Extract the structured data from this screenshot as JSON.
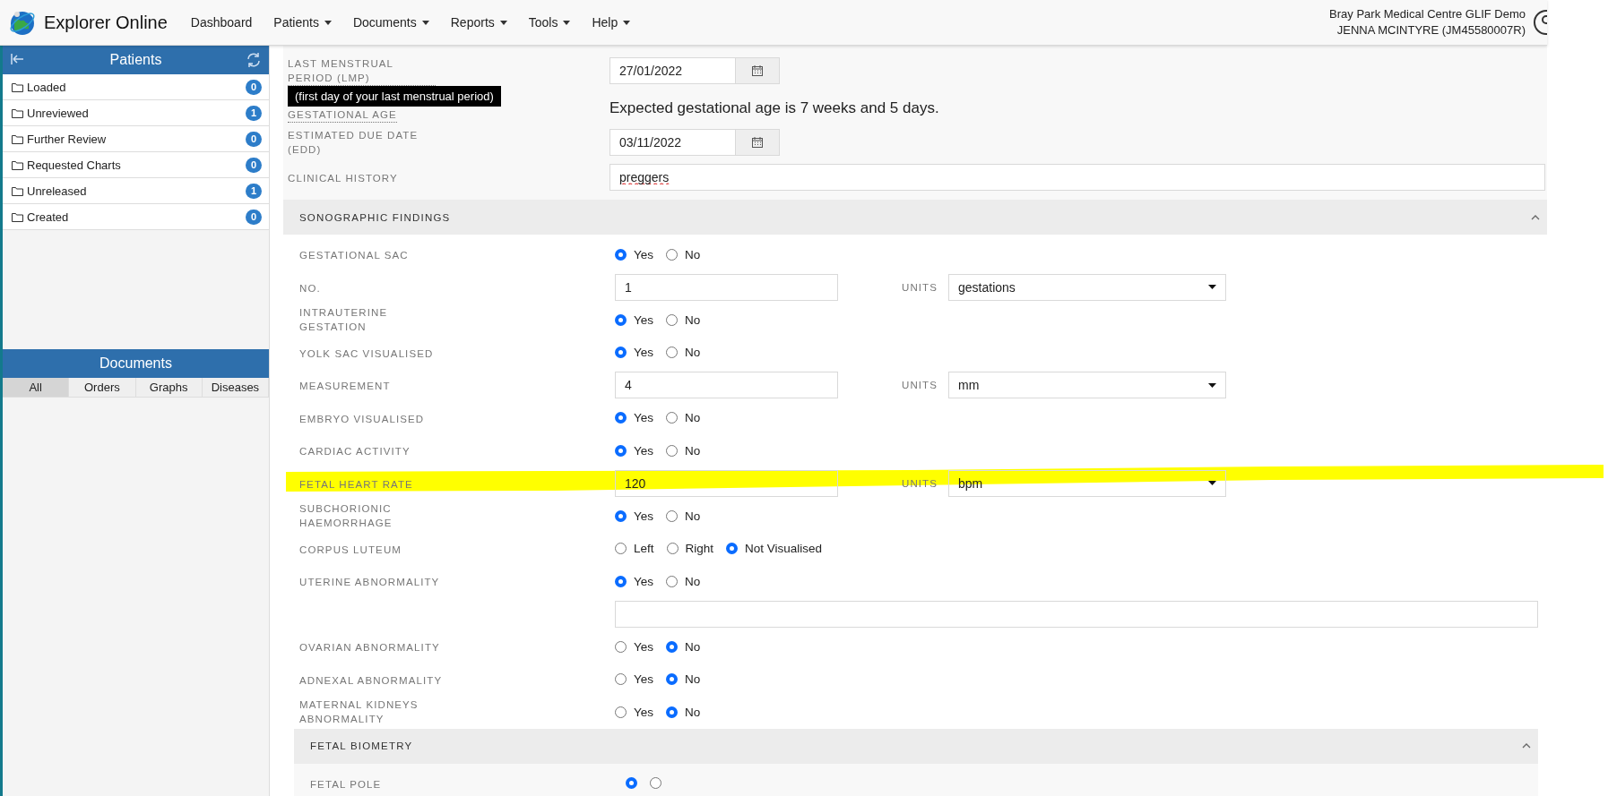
{
  "topbar": {
    "app_title": "Explorer Online",
    "nav": [
      {
        "label": "Dashboard",
        "dropdown": false
      },
      {
        "label": "Patients",
        "dropdown": true
      },
      {
        "label": "Documents",
        "dropdown": true
      },
      {
        "label": "Reports",
        "dropdown": true
      },
      {
        "label": "Tools",
        "dropdown": true
      },
      {
        "label": "Help",
        "dropdown": true
      }
    ],
    "organisation": "Bray Park Medical Centre GLIF Demo",
    "user": "JENNA MCINTYRE (JM45580007R)"
  },
  "sidebar": {
    "patients": {
      "title": "Patients",
      "folders": [
        {
          "label": "Loaded",
          "count": "0"
        },
        {
          "label": "Unreviewed",
          "count": "1"
        },
        {
          "label": "Further Review",
          "count": "0"
        },
        {
          "label": "Requested Charts",
          "count": "0"
        },
        {
          "label": "Unreleased",
          "count": "1"
        },
        {
          "label": "Created",
          "count": "0"
        }
      ]
    },
    "documents": {
      "title": "Documents",
      "tabs": [
        {
          "label": "All",
          "selected": true
        },
        {
          "label": "Orders",
          "selected": false
        },
        {
          "label": "Graphs",
          "selected": false
        },
        {
          "label": "Diseases",
          "selected": false
        }
      ]
    }
  },
  "form": {
    "fields": [
      {
        "kind": "date",
        "label": "LAST MENSTRUAL PERIOD (LMP)",
        "help": true,
        "tooltip": "(first day of your last menstrual period)",
        "value": "27/01/2022"
      },
      {
        "kind": "note",
        "label": "GESTATIONAL AGE",
        "help": true,
        "text": "Expected gestational age is 7 weeks and 5 days."
      },
      {
        "kind": "date",
        "label": "ESTIMATED DUE DATE (EDD)",
        "value": "03/11/2022"
      },
      {
        "kind": "text",
        "label": "CLINICAL HISTORY",
        "value": "preggers",
        "misspelled": true
      }
    ],
    "sections": [
      {
        "title": "SONOGRAPHIC FINDINGS",
        "expanded": true,
        "rows": [
          {
            "kind": "radio",
            "label": "GESTATIONAL SAC",
            "options": [
              {
                "label": "Yes",
                "selected": true
              },
              {
                "label": "No",
                "selected": false
              }
            ]
          },
          {
            "kind": "number",
            "label": "NO.",
            "value": "1",
            "units_label": "UNITS",
            "units": "gestations"
          },
          {
            "kind": "radio",
            "label": "INTRAUTERINE GESTATION",
            "options": [
              {
                "label": "Yes",
                "selected": true
              },
              {
                "label": "No",
                "selected": false
              }
            ]
          },
          {
            "kind": "radio",
            "label": "YOLK SAC VISUALISED",
            "options": [
              {
                "label": "Yes",
                "selected": true
              },
              {
                "label": "No",
                "selected": false
              }
            ]
          },
          {
            "kind": "number",
            "label": "MEASUREMENT",
            "value": "4",
            "units_label": "UNITS",
            "units": "mm"
          },
          {
            "kind": "radio",
            "label": "EMBRYO VISUALISED",
            "options": [
              {
                "label": "Yes",
                "selected": true
              },
              {
                "label": "No",
                "selected": false
              }
            ]
          },
          {
            "kind": "radio",
            "label": "CARDIAC ACTIVITY",
            "options": [
              {
                "label": "Yes",
                "selected": true
              },
              {
                "label": "No",
                "selected": false
              }
            ]
          },
          {
            "kind": "number",
            "label": "FETAL HEART RATE",
            "value": "120",
            "units_label": "UNITS",
            "units": "bpm",
            "highlighted": true
          },
          {
            "kind": "radio",
            "label": "SUBCHORIONIC HAEMORRHAGE",
            "options": [
              {
                "label": "Yes",
                "selected": true
              },
              {
                "label": "No",
                "selected": false
              }
            ]
          },
          {
            "kind": "radio",
            "label": "CORPUS LUTEUM",
            "options": [
              {
                "label": "Left",
                "selected": false
              },
              {
                "label": "Right",
                "selected": false
              },
              {
                "label": "Not Visualised",
                "selected": true
              }
            ]
          },
          {
            "kind": "radio",
            "label": "UTERINE ABNORMALITY",
            "options": [
              {
                "label": "Yes",
                "selected": true
              },
              {
                "label": "No",
                "selected": false
              }
            ]
          },
          {
            "kind": "free_text"
          },
          {
            "kind": "radio",
            "label": "OVARIAN ABNORMALITY",
            "options": [
              {
                "label": "Yes",
                "selected": false
              },
              {
                "label": "No",
                "selected": true
              }
            ]
          },
          {
            "kind": "radio",
            "label": "ADNEXAL ABNORMALITY",
            "options": [
              {
                "label": "Yes",
                "selected": false
              },
              {
                "label": "No",
                "selected": true
              }
            ]
          },
          {
            "kind": "radio",
            "label": "MATERNAL KIDNEYS ABNORMALITY",
            "options": [
              {
                "label": "Yes",
                "selected": false
              },
              {
                "label": "No",
                "selected": true
              }
            ]
          },
          {
            "kind": "section",
            "title": "FETAL BIOMETRY",
            "expanded": true,
            "rows": [
              {
                "kind": "radio",
                "label": "FETAL POLE",
                "options": [
                  {
                    "selected": true
                  },
                  {
                    "selected": false
                  }
                ]
              }
            ]
          }
        ]
      }
    ]
  }
}
